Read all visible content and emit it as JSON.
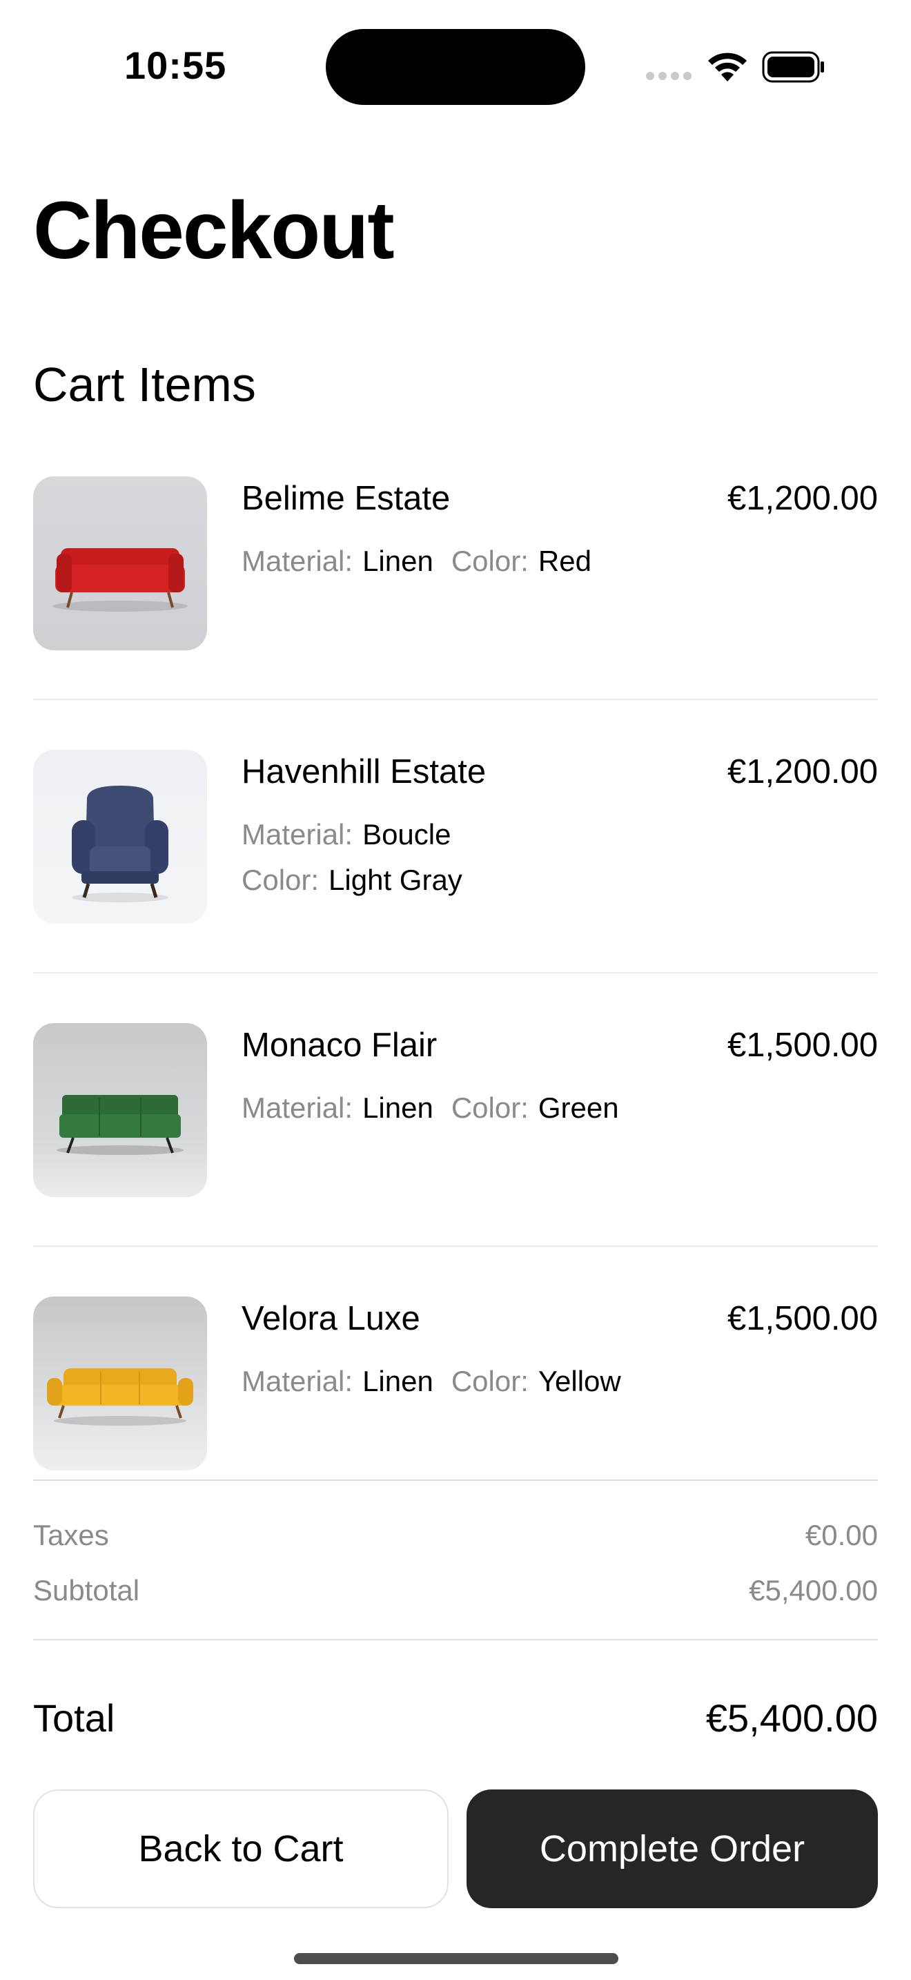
{
  "status_bar": {
    "time": "10:55"
  },
  "page": {
    "title": "Checkout",
    "section_title": "Cart Items"
  },
  "cart_items": [
    {
      "name": "Belime Estate",
      "price": "€1,200.00",
      "material_label": "Material:",
      "material": "Linen",
      "color_label": "Color:",
      "color": "Red",
      "swatch": "#d11f1f",
      "image": "red sofa"
    },
    {
      "name": "Havenhill Estate",
      "price": "€1,200.00",
      "material_label": "Material:",
      "material": "Boucle",
      "color_label": "Color:",
      "color": "Light Gray",
      "swatch": "#3f4a6e",
      "image": "navy wingback armchair"
    },
    {
      "name": "Monaco Flair",
      "price": "€1,500.00",
      "material_label": "Material:",
      "material": "Linen",
      "color_label": "Color:",
      "color": "Green",
      "swatch": "#2f6b3a",
      "image": "green sofa"
    },
    {
      "name": "Velora Luxe",
      "price": "€1,500.00",
      "material_label": "Material:",
      "material": "Linen",
      "color_label": "Color:",
      "color": "Yellow",
      "swatch": "#f2b526",
      "image": "yellow sofa"
    }
  ],
  "summary": {
    "taxes_label": "Taxes",
    "taxes": "€0.00",
    "subtotal_label": "Subtotal",
    "subtotal": "€5,400.00",
    "total_label": "Total",
    "total": "€5,400.00"
  },
  "actions": {
    "back_label": "Back to Cart",
    "complete_label": "Complete Order"
  },
  "colors": {
    "button_dark": "#262626",
    "secondary_text": "#8a8a8e"
  }
}
